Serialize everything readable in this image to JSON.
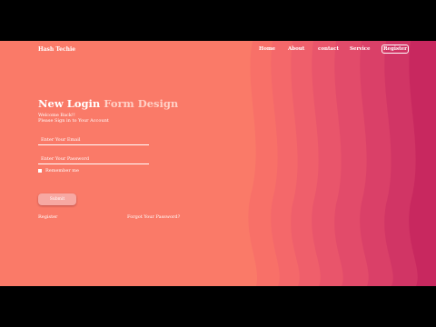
{
  "header": {
    "brand": "Hash Techie",
    "nav": [
      "Home",
      "About",
      "contact",
      "Service"
    ],
    "register_button": "Register"
  },
  "form": {
    "title_white": "New Login",
    "title_faded": "Form Design",
    "welcome": "Welcome Back!!",
    "prompt": "Please Sign in to Your Account",
    "email_placeholder": "Enter Your Email",
    "password_placeholder": "Enter Your Password",
    "remember_label": "Remember me",
    "submit_label": "Submit",
    "register_link": "Register",
    "forgot_link": "Forgot Your Password?"
  },
  "colors": {
    "background": "#fa7a68",
    "accent_dark": "#c8245e",
    "button": "#f7a8a2"
  }
}
